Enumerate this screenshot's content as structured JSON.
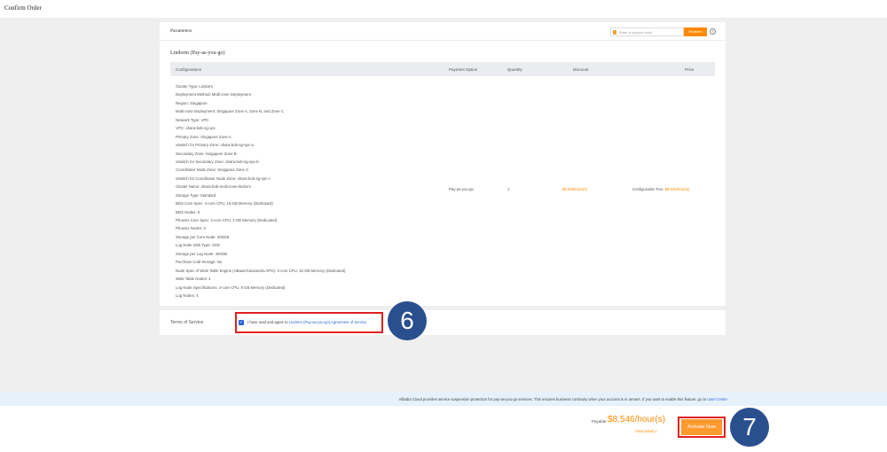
{
  "page_title": "Confirm Order",
  "parameters": {
    "label": "Parameters",
    "coupon_placeholder": "Enter a coupon code",
    "redeem_label": "Redeem",
    "help_icon": "?"
  },
  "product_title": "Lindorm (Pay-as-you-go)",
  "table": {
    "headers": [
      "Configurations",
      "Payment Option",
      "Quantity",
      "Discount",
      "Price"
    ],
    "configurations": [
      "Cluster Type: Lindorm",
      "Deployment Method: Multi-zone Deployment",
      "Region: Singapore",
      "Multi-zone Deployment: Singapore Zone A, Zone B, and Zone C",
      "Network Type: VPC",
      "VPC: ohara-bob-sg-vpc",
      "Primary Zone: Singapore Zone A",
      "vSwitch for Primary Zone: ohara-bob-sg-vpc-a",
      "Secondary Zone: Singapore Zone B",
      "vSwitch for Secondary Zone: ohara-bob-sg-vpc-b",
      "Coordinator Node Zone: Singapore Zone C",
      "vSwitch for Coordinator Node Zone: ohara-bob-sg-vpc-c",
      "Cluster Name: ohara-bob-multi-zone-lindorm",
      "Storage Type: Standard",
      "BDS Core Spec: 4-core CPU, 16 GB Memory (Dedicated)",
      "BDS Nodes: 0",
      "Phoenix Core Spec: 2-core CPU, 4 GB Memory (Dedicated)",
      "Phoenix Nodes: 0",
      "Storage per Core Node: 400GB",
      "Log Node Disk Type: SSD",
      "Storage per Log Node: 400GB",
      "Purchase Cold Storage: No",
      "Node Spec of Wide Table Engine (HBase/Cassandra APIs): 4-core CPU, 16 GB Memory (Dedicated)",
      "Wide Table Nodes: 4",
      "Log Node Specifications: 4-core CPU, 8 GB Memory (Dedicated)",
      "Log Nodes: 4"
    ],
    "payment_option": "Pay-as-you-go",
    "quantity": "1",
    "discount": "$0.000/hour(s)",
    "price_label": "Configuration Fee:",
    "price_value": "$8.546/hour(s)"
  },
  "terms": {
    "label": "Terms of Service",
    "agree_text": "I have read and agree to",
    "agree_link": "Lindorm (Pay-as-you-go) Agreement of Service",
    "checked": true
  },
  "notice": {
    "text": "Alibaba Cloud provides service suspension protection for pay-as-you-go services. This ensures business continuity when your account is in arrears. If you want to enable this feature, go to",
    "link": "User Center"
  },
  "footer": {
    "payable_label": "Payable:",
    "amount": "$8.546/hour(s)",
    "view_detail": "View Detail ∨",
    "activate_label": "Activate Now"
  },
  "annotations": {
    "step6": "6",
    "step7": "7"
  }
}
